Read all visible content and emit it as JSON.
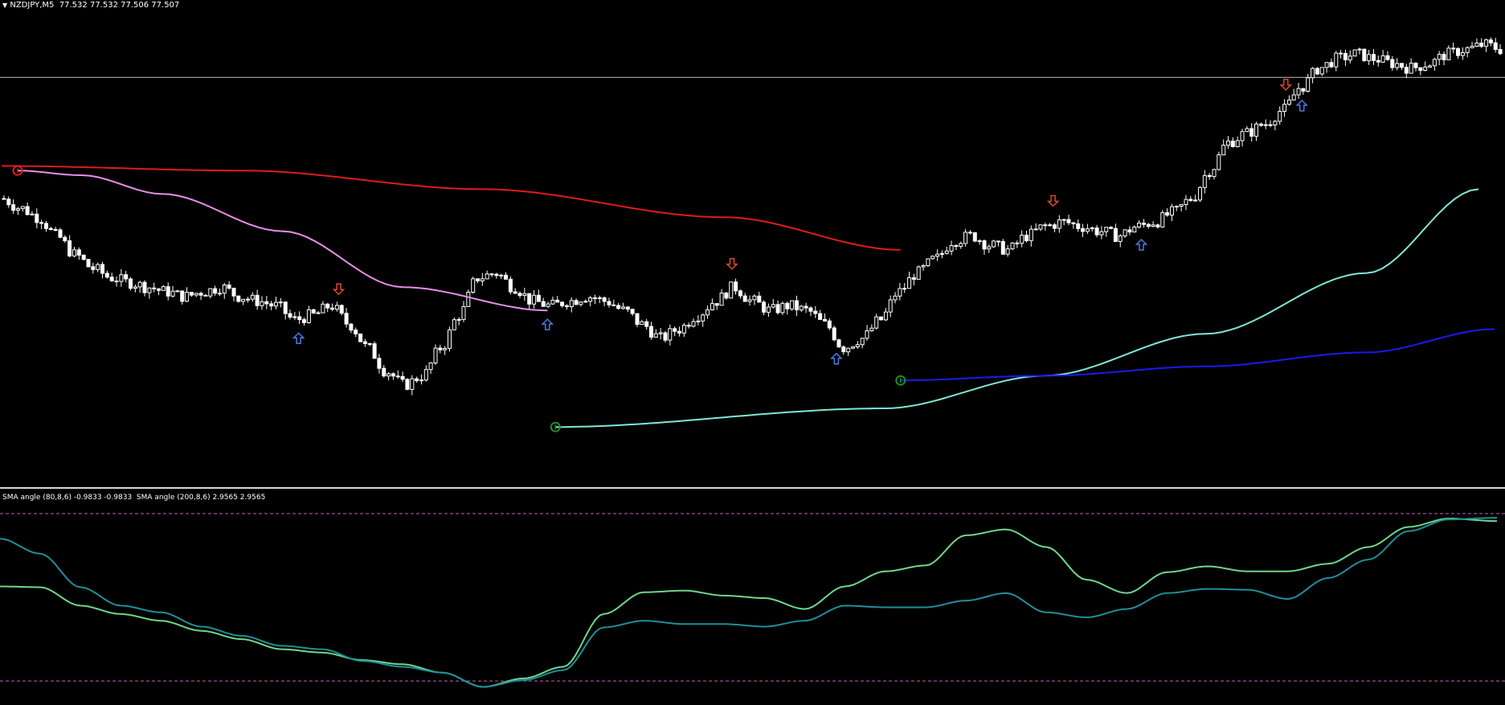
{
  "symbol": {
    "triangle": "▼",
    "name": "NZDJPY,M5",
    "ohlc": "77.532 77.532 77.506 77.507"
  },
  "indicator_label": "SMA angle (80,8,6) -0.9833 -0.9833  SMA angle (200,8,6) 2.9565 2.9565",
  "colors": {
    "background": "#000000",
    "candle": "#ffffff",
    "up_tick": "#00c000",
    "sma_red": "#e01b1b",
    "sma_violet": "#e98ee9",
    "ma_cyan": "#7fe7d8",
    "ma_blue": "#1a1aef",
    "angle_fast": "#6fd68a",
    "angle_slow": "#1f8f9a",
    "buy_arrow": "#4a7be0",
    "sell_arrow": "#d84a2a",
    "level_dashed": "#c060c0",
    "hline": "#c0c0c0"
  },
  "chart_data": [
    {
      "type": "candlestick",
      "panel": "main",
      "y_domain": [
        0,
        100
      ],
      "x_domain": [
        0,
        187
      ],
      "horizontal_line_y": 86,
      "ohlc_path": [
        [
          0,
          60
        ],
        [
          4,
          58
        ],
        [
          8,
          56
        ],
        [
          12,
          52
        ],
        [
          16,
          48
        ],
        [
          20,
          45
        ],
        [
          24,
          43
        ],
        [
          28,
          42
        ],
        [
          32,
          41
        ],
        [
          36,
          40
        ],
        [
          40,
          39
        ],
        [
          44,
          40
        ],
        [
          48,
          41
        ],
        [
          52,
          39
        ],
        [
          56,
          38
        ],
        [
          60,
          37
        ],
        [
          64,
          34
        ],
        [
          68,
          35
        ],
        [
          72,
          37
        ],
        [
          76,
          33
        ],
        [
          80,
          28
        ],
        [
          84,
          23
        ],
        [
          88,
          20
        ],
        [
          92,
          22
        ],
        [
          96,
          28
        ],
        [
          100,
          35
        ],
        [
          104,
          43
        ],
        [
          108,
          44
        ],
        [
          112,
          41
        ],
        [
          116,
          38
        ],
        [
          120,
          37
        ],
        [
          124,
          38
        ],
        [
          128,
          39
        ],
        [
          132,
          38
        ],
        [
          136,
          36
        ],
        [
          140,
          33
        ],
        [
          144,
          30
        ],
        [
          148,
          32
        ],
        [
          152,
          35
        ],
        [
          156,
          38
        ],
        [
          160,
          41
        ],
        [
          164,
          38
        ],
        [
          168,
          36
        ],
        [
          172,
          37
        ],
        [
          176,
          36
        ],
        [
          180,
          33
        ],
        [
          184,
          28
        ],
        [
          188,
          30
        ],
        [
          192,
          34
        ],
        [
          196,
          40
        ],
        [
          200,
          44
        ],
        [
          204,
          47
        ],
        [
          208,
          51
        ],
        [
          212,
          52
        ],
        [
          216,
          50
        ],
        [
          220,
          49
        ],
        [
          224,
          52
        ],
        [
          228,
          54
        ],
        [
          232,
          55
        ],
        [
          236,
          54
        ],
        [
          240,
          53
        ],
        [
          244,
          52
        ],
        [
          248,
          54
        ],
        [
          252,
          55
        ],
        [
          256,
          57
        ],
        [
          260,
          60
        ],
        [
          264,
          66
        ],
        [
          268,
          72
        ],
        [
          272,
          74
        ],
        [
          276,
          76
        ],
        [
          280,
          79
        ],
        [
          284,
          84
        ],
        [
          288,
          88
        ],
        [
          292,
          90
        ],
        [
          296,
          91
        ],
        [
          300,
          90
        ],
        [
          304,
          89
        ],
        [
          308,
          88
        ],
        [
          312,
          89
        ],
        [
          316,
          91
        ],
        [
          320,
          92
        ],
        [
          324,
          93
        ],
        [
          328,
          92
        ]
      ],
      "red_sma": [
        [
          0,
          67
        ],
        [
          30,
          66
        ],
        [
          60,
          62
        ],
        [
          90,
          56
        ],
        [
          112,
          49
        ]
      ],
      "violet_sma": [
        [
          2,
          66
        ],
        [
          10,
          65
        ],
        [
          20,
          61
        ],
        [
          35,
          53
        ],
        [
          50,
          41
        ],
        [
          68,
          36
        ]
      ],
      "cyan_ma": [
        [
          69,
          11
        ],
        [
          110,
          15
        ],
        [
          130,
          22
        ],
        [
          150,
          31
        ],
        [
          170,
          44
        ],
        [
          184,
          62
        ]
      ],
      "blue_ma": [
        [
          112,
          21
        ],
        [
          130,
          22
        ],
        [
          150,
          24
        ],
        [
          170,
          27
        ],
        [
          186,
          32
        ]
      ],
      "buy_arrows_x": [
        37,
        68,
        104,
        142,
        162
      ],
      "sell_arrows_x": [
        42,
        91,
        131,
        160
      ],
      "circle_markers": [
        {
          "x": 2,
          "y": 66,
          "color": "#e01b1b"
        },
        {
          "x": 69,
          "y": 11,
          "color": "#1f8f1f"
        },
        {
          "x": 112,
          "y": 21,
          "color": "#1f8f1f"
        }
      ]
    },
    {
      "type": "line",
      "panel": "indicator",
      "y_domain": [
        -1.2,
        1.2
      ],
      "x_domain": [
        0,
        187
      ],
      "levels": [
        1.0,
        -1.0
      ],
      "series": [
        {
          "values": [
            [
              0,
              0.13
            ],
            [
              5,
              0.12
            ],
            [
              10,
              -0.1
            ],
            [
              15,
              -0.2
            ],
            [
              20,
              -0.28
            ],
            [
              25,
              -0.4
            ],
            [
              30,
              -0.5
            ],
            [
              35,
              -0.62
            ],
            [
              40,
              -0.66
            ],
            [
              45,
              -0.75
            ],
            [
              50,
              -0.8
            ],
            [
              55,
              -0.9
            ],
            [
              60,
              -1.07
            ],
            [
              65,
              -0.97
            ],
            [
              70,
              -0.83
            ],
            [
              75,
              -0.2
            ],
            [
              80,
              0.06
            ],
            [
              85,
              0.08
            ],
            [
              90,
              0.02
            ],
            [
              95,
              -0.01
            ],
            [
              100,
              -0.14
            ],
            [
              105,
              0.13
            ],
            [
              110,
              0.31
            ],
            [
              115,
              0.38
            ],
            [
              120,
              0.74
            ],
            [
              125,
              0.81
            ],
            [
              130,
              0.6
            ],
            [
              135,
              0.21
            ],
            [
              140,
              0.05
            ],
            [
              145,
              0.3
            ],
            [
              150,
              0.37
            ],
            [
              155,
              0.31
            ],
            [
              160,
              0.31
            ],
            [
              165,
              0.4
            ],
            [
              170,
              0.6
            ],
            [
              175,
              0.84
            ],
            [
              180,
              0.94
            ],
            [
              186,
              0.91
            ]
          ]
        },
        {
          "values": [
            [
              0,
              0.7
            ],
            [
              5,
              0.52
            ],
            [
              10,
              0.12
            ],
            [
              15,
              -0.1
            ],
            [
              20,
              -0.18
            ],
            [
              25,
              -0.35
            ],
            [
              30,
              -0.46
            ],
            [
              35,
              -0.58
            ],
            [
              40,
              -0.62
            ],
            [
              45,
              -0.76
            ],
            [
              50,
              -0.83
            ],
            [
              55,
              -0.9
            ],
            [
              60,
              -1.07
            ],
            [
              65,
              -0.99
            ],
            [
              70,
              -0.87
            ],
            [
              75,
              -0.36
            ],
            [
              80,
              -0.28
            ],
            [
              85,
              -0.32
            ],
            [
              90,
              -0.32
            ],
            [
              95,
              -0.35
            ],
            [
              100,
              -0.28
            ],
            [
              105,
              -0.1
            ],
            [
              110,
              -0.12
            ],
            [
              115,
              -0.12
            ],
            [
              120,
              -0.04
            ],
            [
              125,
              0.05
            ],
            [
              130,
              -0.18
            ],
            [
              135,
              -0.24
            ],
            [
              140,
              -0.14
            ],
            [
              145,
              0.05
            ],
            [
              150,
              0.1
            ],
            [
              155,
              0.09
            ],
            [
              160,
              -0.02
            ],
            [
              165,
              0.23
            ],
            [
              170,
              0.45
            ],
            [
              175,
              0.79
            ],
            [
              180,
              0.93
            ],
            [
              186,
              0.95
            ]
          ]
        }
      ]
    }
  ]
}
